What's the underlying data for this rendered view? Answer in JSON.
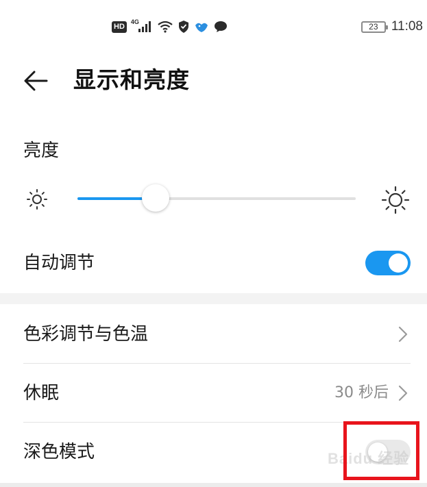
{
  "status_bar": {
    "hd": "HD",
    "network": "4G",
    "battery": "23",
    "time": "11:08"
  },
  "header": {
    "title": "显示和亮度"
  },
  "brightness": {
    "label": "亮度",
    "level": 0.28
  },
  "auto_adjust": {
    "label": "自动调节",
    "enabled": true
  },
  "settings": [
    {
      "label": "色彩调节与色温"
    },
    {
      "label": "休眠",
      "value": "30 秒后"
    },
    {
      "label": "深色模式",
      "enabled": false
    }
  ],
  "watermark": "Baidu 经验",
  "colors": {
    "accent": "#1a97f0",
    "highlight": "#e8141c"
  }
}
